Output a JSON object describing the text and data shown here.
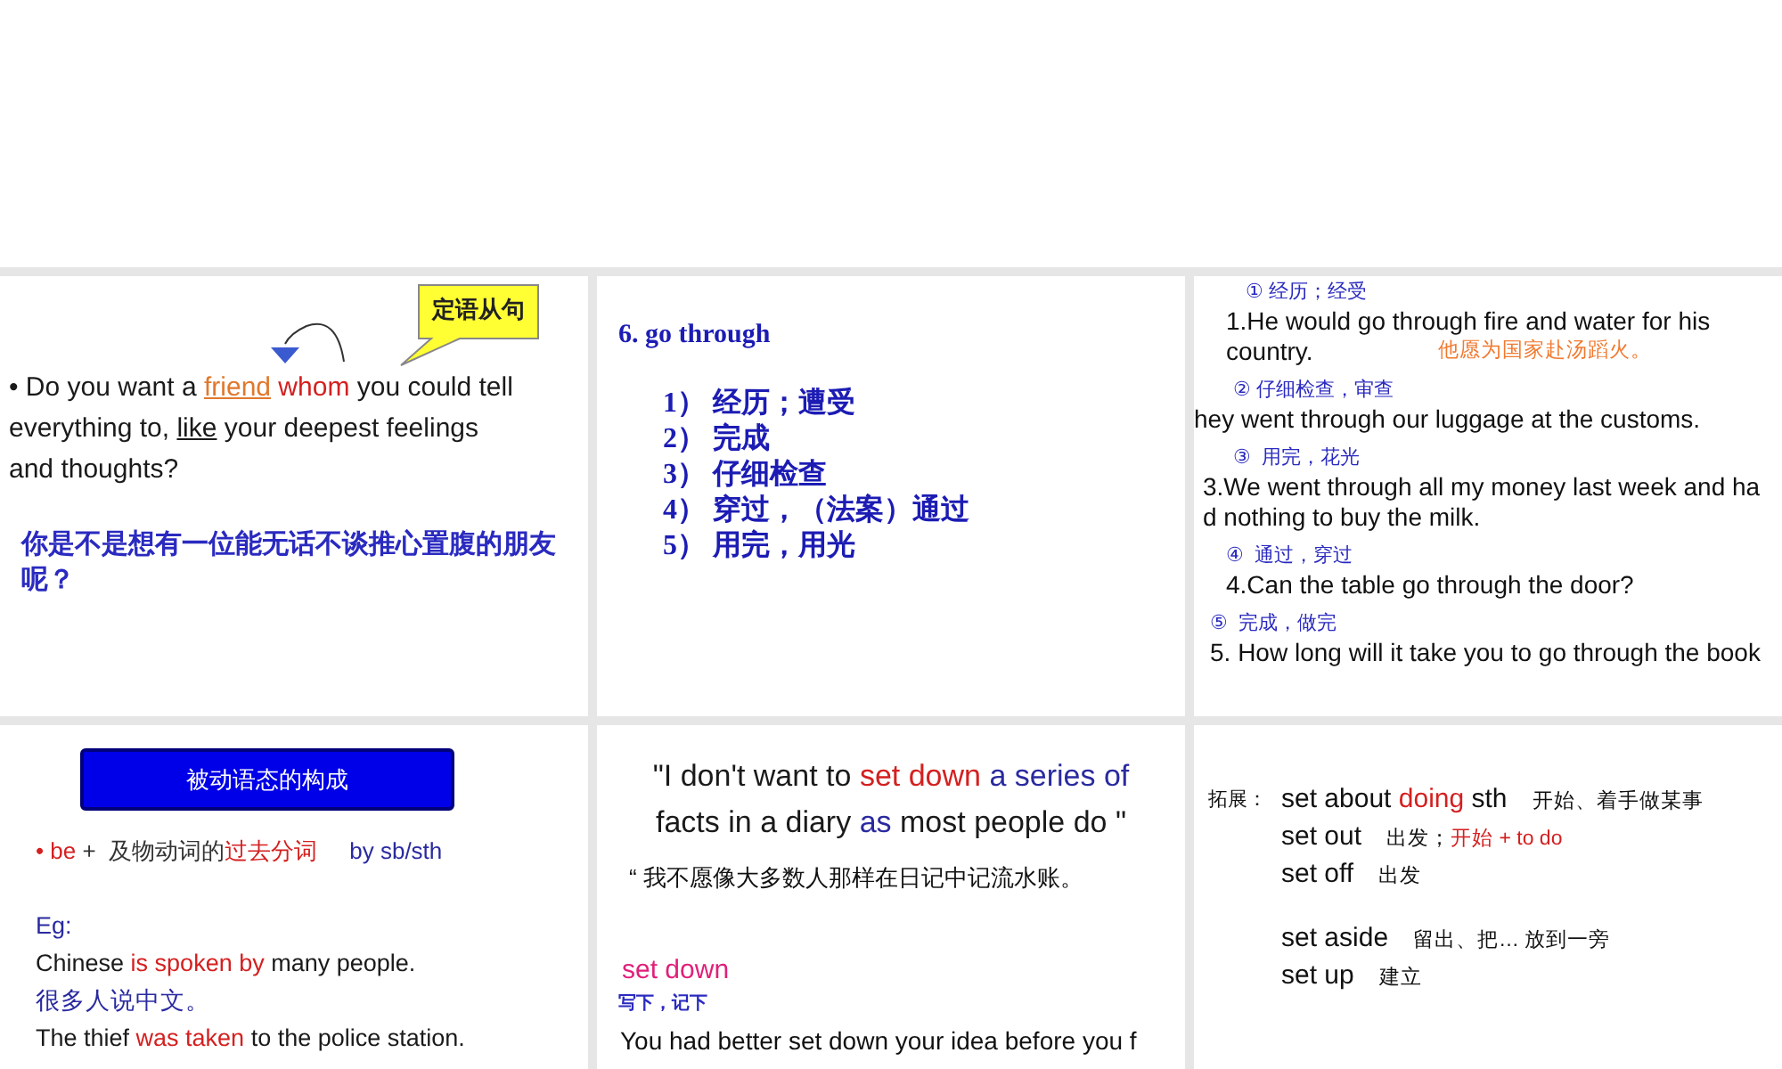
{
  "slides": [
    {
      "kind": "relative_clause",
      "callout": "定语从句",
      "paragraph": [
        {
          "text": "• Do you want a ",
          "color": "#1a1a1a",
          "underline": false
        },
        {
          "text": "friend",
          "color": "#e0782c",
          "underline": true
        },
        {
          "text": " whom",
          "color": "#d42020",
          "underline": false
        },
        {
          "text": " you could tell everything to, ",
          "color": "#1a1a1a",
          "underline": false
        },
        {
          "text": "like",
          "color": "#1a1a1a",
          "underline": true
        },
        {
          "text": " your deepest feelings and thoughts?",
          "color": "#1a1a1a",
          "underline": false
        }
      ],
      "translation": "你是不是想有一位能无话不谈推心置腹的朋友呢？"
    },
    {
      "kind": "phrase_list",
      "title": "6. go through",
      "items": [
        {
          "number": "1）",
          "text": "经历；遭受"
        },
        {
          "number": "2）",
          "text": "完成"
        },
        {
          "number": "3）",
          "text": "仔细检查"
        },
        {
          "number": "4）",
          "text": "穿过，（法案）通过"
        },
        {
          "number": "5）",
          "text": "用完，用光"
        }
      ]
    },
    {
      "kind": "senses",
      "senses": [
        {
          "label": "① 经历；经受",
          "lines": [
            "1.He would go through fire and water for his",
            "country."
          ],
          "translation": "他愿为国家赴汤蹈火。"
        },
        {
          "label": "② 仔细检查，审查",
          "lines": [
            "hey went through our luggage at the customs."
          ]
        },
        {
          "label": "③  用完，花光",
          "lines": [
            "3.We went through all my money last week and ha",
            "d nothing to buy the milk."
          ]
        },
        {
          "label": "④  通过，穿过",
          "lines": [
            "4.Can the table go through the door?"
          ]
        },
        {
          "label": "⑤  完成，做完",
          "lines": [
            "5. How long will it take you to go through the book"
          ]
        }
      ]
    },
    {
      "kind": "passive",
      "banner": "被动语态的构成",
      "lines": [
        {
          "kind": "formula",
          "segments": [
            {
              "text": "• be",
              "color": "#d42020"
            },
            {
              "text": " +  及物动词的",
              "color": "#333333"
            },
            {
              "text": "过去分词",
              "color": "#d42020"
            },
            {
              "text": "     by sb/sth",
              "color": "#2a2aa0"
            }
          ]
        },
        {
          "kind": "example",
          "segments": [
            {
              "text": "Eg:",
              "color": "#2a2aa0"
            }
          ]
        },
        {
          "kind": "example",
          "segments": [
            {
              "text": "Chinese ",
              "color": "#1a1a1a"
            },
            {
              "text": "is spoken by",
              "color": "#d42020"
            },
            {
              "text": " many people.",
              "color": "#1a1a1a"
            }
          ]
        },
        {
          "kind": "example",
          "segments": [
            {
              "text": "很多人说中文。",
              "color": "#2a2aa0"
            }
          ]
        },
        {
          "kind": "example",
          "segments": [
            {
              "text": "The thief ",
              "color": "#1a1a1a"
            },
            {
              "text": "was taken",
              "color": "#d42020"
            },
            {
              "text": " to the police station.",
              "color": "#1a1a1a"
            }
          ]
        }
      ]
    },
    {
      "kind": "quote",
      "quote_lines": [
        [
          {
            "text": "\"I don't want to ",
            "color": "#1a1a1a"
          },
          {
            "text": "set down",
            "color": "#d42020"
          },
          {
            "text": " a series of",
            "color": "#2a2aa0"
          }
        ],
        [
          {
            "text": "facts in a diary ",
            "color": "#1a1a1a"
          },
          {
            "text": "as",
            "color": "#2a2aa0"
          },
          {
            "text": " most people do \"",
            "color": "#1a1a1a"
          }
        ]
      ],
      "translation": "“ 我不愿像大多数人那样在日记中记流水账。",
      "phrase": "set down",
      "meaning": "写下，记下",
      "example": "You had better set down your idea before you f"
    },
    {
      "kind": "expansion",
      "label": "拓展：",
      "groups": [
        [
          {
            "term": [
              {
                "text": "set about ",
                "color": "#111111"
              },
              {
                "text": "doing",
                "color": "#d42020"
              },
              {
                "text": " sth",
                "color": "#111111"
              }
            ],
            "gloss": [
              {
                "text": "开始、着手做某事",
                "color": "#111111"
              }
            ]
          },
          {
            "term": [
              {
                "text": "set out",
                "color": "#111111"
              }
            ],
            "gloss": [
              {
                "text": "出发；",
                "color": "#111111"
              },
              {
                "text": "开始 + to do",
                "color": "#d42020"
              }
            ]
          },
          {
            "term": [
              {
                "text": "set off",
                "color": "#111111"
              }
            ],
            "gloss": [
              {
                "text": "出发",
                "color": "#111111"
              }
            ]
          }
        ],
        [
          {
            "term": [
              {
                "text": "set aside",
                "color": "#111111"
              }
            ],
            "gloss": [
              {
                "text": "留出、把… 放到一旁",
                "color": "#111111"
              }
            ]
          },
          {
            "term": [
              {
                "text": "set up",
                "color": "#111111"
              }
            ],
            "gloss": [
              {
                "text": "建立",
                "color": "#111111"
              }
            ]
          }
        ]
      ]
    }
  ]
}
